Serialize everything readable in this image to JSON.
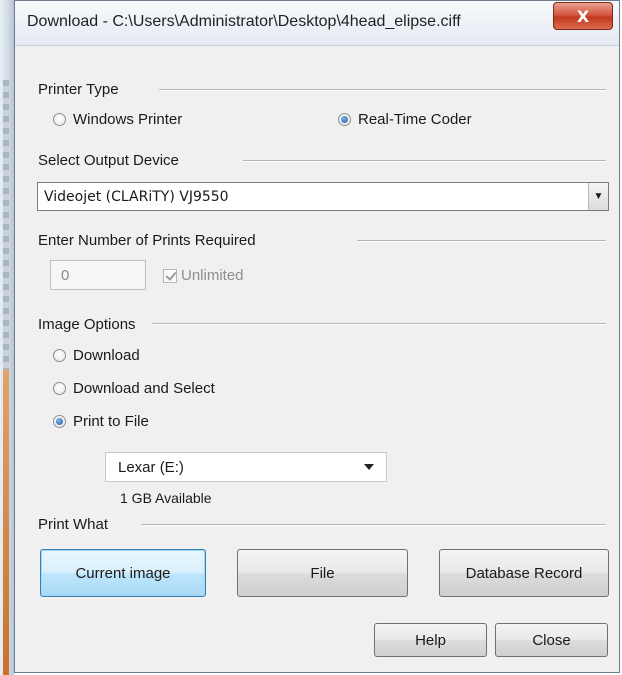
{
  "window": {
    "title": "Download - C:\\Users\\Administrator\\Desktop\\4head_elipse.ciff",
    "close_glyph": "X"
  },
  "printer_type": {
    "label": "Printer Type",
    "options": [
      {
        "label": "Windows Printer",
        "selected": false
      },
      {
        "label": "Real-Time Coder",
        "selected": true
      }
    ]
  },
  "output_device": {
    "label": "Select Output Device",
    "value": "Videojet (CLARiTY) VJ9550",
    "arrow": "▼"
  },
  "prints": {
    "label": "Enter Number of Prints Required",
    "value": "0",
    "unlimited_label": "Unlimited",
    "unlimited_checked": true,
    "enabled": false
  },
  "image_options": {
    "label": "Image Options",
    "options": [
      {
        "label": "Download",
        "selected": false
      },
      {
        "label": "Download and Select",
        "selected": false
      },
      {
        "label": "Print to File",
        "selected": true
      }
    ],
    "drive": {
      "value": "Lexar (E:)",
      "available": "1 GB Available"
    }
  },
  "print_what": {
    "label": "Print What",
    "buttons": [
      "Current image",
      "File",
      "Database Record"
    ],
    "active": "Current image"
  },
  "footer": {
    "help_label": "Help",
    "close_label": "Close"
  },
  "colors": {
    "dialog_bg": "#f0f0f0",
    "close_button": "#c23a20",
    "active_button": "#bee6fd",
    "radio_selected": "#1c5aa8"
  },
  "icons": {
    "close": "close-icon",
    "combo_arrow": "chevron-down-icon",
    "checkbox": "checkmark-icon"
  }
}
